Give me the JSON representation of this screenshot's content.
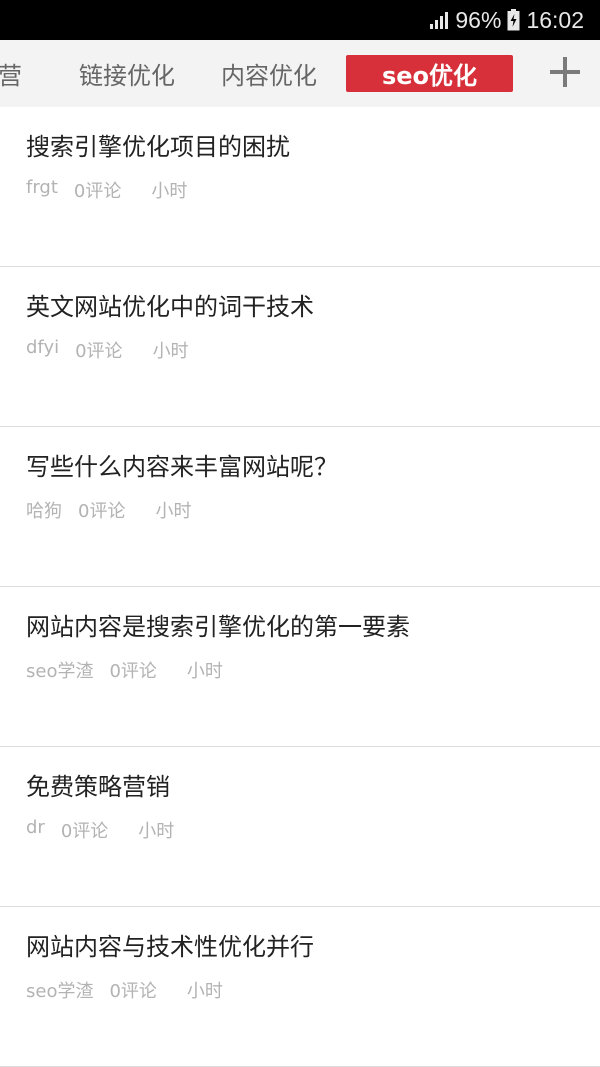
{
  "status_bar": {
    "battery": "96%",
    "time": "16:02",
    "icons": [
      "signal-icon",
      "battery-icon"
    ]
  },
  "tabs": [
    {
      "label": "营"
    },
    {
      "label": "链接优化"
    },
    {
      "label": "内容优化"
    },
    {
      "label": "seo优化",
      "active": true
    }
  ],
  "add_tab_icon": "plus-icon",
  "colors": {
    "accent": "#d7303a",
    "tab_bg": "#f3f3f3",
    "meta_text": "#b3b3b3"
  },
  "articles": [
    {
      "title": "搜索引擎优化项目的困扰",
      "author": "frgt",
      "comments": "0评论",
      "time": "小时"
    },
    {
      "title": "英文网站优化中的词干技术",
      "author": "dfyi",
      "comments": "0评论",
      "time": "小时"
    },
    {
      "title": "写些什么内容来丰富网站呢？",
      "author": "哈狗",
      "comments": "0评论",
      "time": "小时"
    },
    {
      "title": "网站内容是搜索引擎优化的第一要素",
      "author": "seo学渣",
      "comments": "0评论",
      "time": "小时"
    },
    {
      "title": "免费策略营销",
      "author": "dr",
      "comments": "0评论",
      "time": "小时"
    },
    {
      "title": "网站内容与技术性优化并行",
      "author": "seo学渣",
      "comments": "0评论",
      "time": "小时"
    }
  ]
}
